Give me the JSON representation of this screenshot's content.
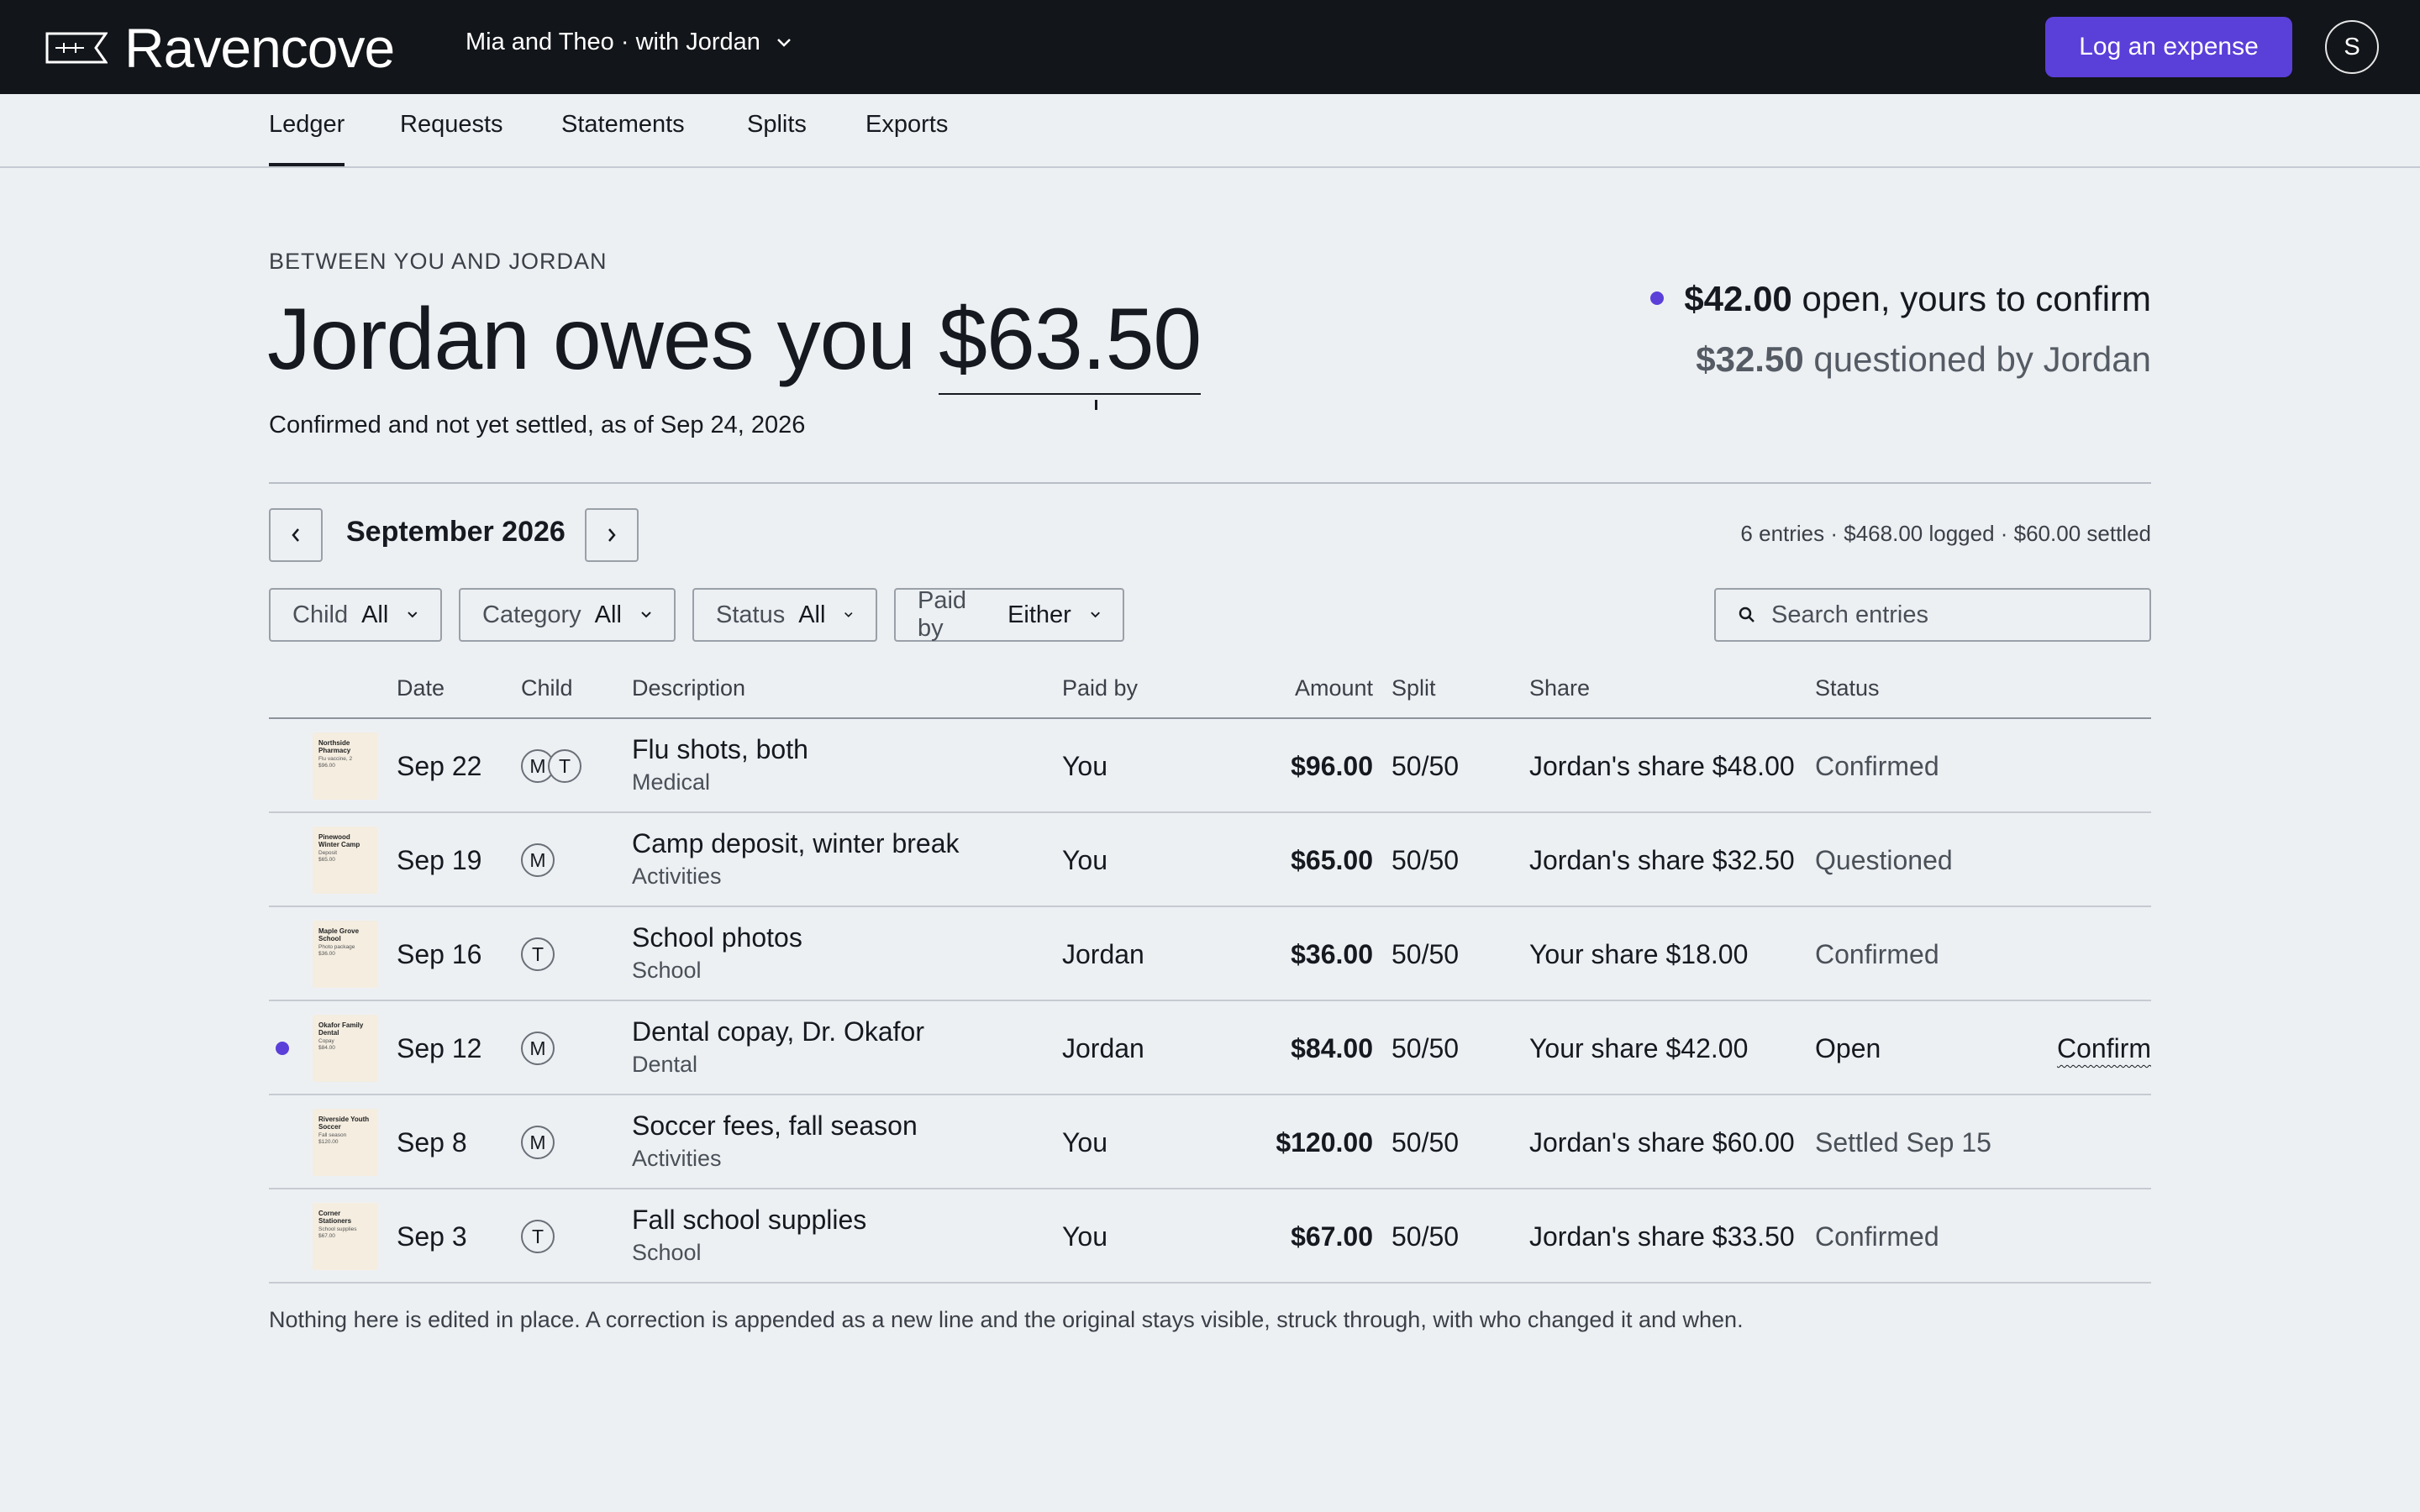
{
  "app": {
    "brand": "Ravencove",
    "household": "Mia and Theo · with Jordan",
    "log_expense": "Log an expense",
    "avatar_initial": "S"
  },
  "tabs": [
    {
      "label": "Ledger",
      "active": true
    },
    {
      "label": "Requests",
      "active": false
    },
    {
      "label": "Statements",
      "active": false
    },
    {
      "label": "Splits",
      "active": false
    },
    {
      "label": "Exports",
      "active": false
    }
  ],
  "hero": {
    "eyebrow": "BETWEEN YOU AND JORDAN",
    "headline_prefix": "Jordan owes you",
    "headline_amount": "$63.50",
    "subtitle": "Confirmed and not yet settled, as of Sep 24, 2026"
  },
  "summary": {
    "open_amount": "$42.00",
    "open_text": "open, yours to confirm",
    "questioned_amount": "$32.50",
    "questioned_text": "questioned by Jordan"
  },
  "period": {
    "month": "September 2026",
    "meta": "6 entries · $468.00 logged · $60.00 settled"
  },
  "filters": [
    {
      "label": "Child",
      "value": "All"
    },
    {
      "label": "Category",
      "value": "All"
    },
    {
      "label": "Status",
      "value": "All"
    },
    {
      "label": "Paid by",
      "value": "Either"
    }
  ],
  "search": {
    "placeholder": "Search entries"
  },
  "columns": [
    "Date",
    "Child",
    "Description",
    "Paid by",
    "Amount",
    "Split",
    "Share",
    "Status"
  ],
  "rows": [
    {
      "date": "Sep 22",
      "children": [
        "M",
        "T"
      ],
      "description": "Flu shots, both",
      "category": "Medical",
      "paid_by": "You",
      "amount": "$96.00",
      "split": "50/50",
      "share": "Jordan's share $48.00",
      "status": "Confirmed",
      "receipt": {
        "merchant": "Northside Pharmacy",
        "line": "Flu vaccine, 2",
        "total": "$96.00"
      }
    },
    {
      "date": "Sep 19",
      "children": [
        "M"
      ],
      "description": "Camp deposit, winter break",
      "category": "Activities",
      "paid_by": "You",
      "amount": "$65.00",
      "split": "50/50",
      "share": "Jordan's share $32.50",
      "status": "Questioned",
      "receipt": {
        "merchant": "Pinewood Winter Camp",
        "line": "Deposit",
        "total": "$65.00"
      }
    },
    {
      "date": "Sep 16",
      "children": [
        "T"
      ],
      "description": "School photos",
      "category": "School",
      "paid_by": "Jordan",
      "amount": "$36.00",
      "split": "50/50",
      "share": "Your share $18.00",
      "status": "Confirmed",
      "receipt": {
        "merchant": "Maple Grove School",
        "line": "Photo package",
        "total": "$36.00"
      }
    },
    {
      "date": "Sep 12",
      "children": [
        "M"
      ],
      "description": "Dental copay, Dr. Okafor",
      "category": "Dental",
      "paid_by": "Jordan",
      "amount": "$84.00",
      "split": "50/50",
      "share": "Your share $42.00",
      "status": "Open",
      "action": "Confirm",
      "receipt": {
        "merchant": "Okafor Family Dental",
        "line": "Copay",
        "total": "$84.00"
      }
    },
    {
      "date": "Sep 8",
      "children": [
        "M"
      ],
      "description": "Soccer fees, fall season",
      "category": "Activities",
      "paid_by": "You",
      "amount": "$120.00",
      "split": "50/50",
      "share": "Jordan's share $60.00",
      "status": "Settled Sep 15",
      "receipt": {
        "merchant": "Riverside Youth Soccer",
        "line": "Fall season",
        "total": "$120.00"
      }
    },
    {
      "date": "Sep 3",
      "children": [
        "T"
      ],
      "description": "Fall school supplies",
      "category": "School",
      "paid_by": "You",
      "amount": "$67.00",
      "split": "50/50",
      "share": "Jordan's share $33.50",
      "status": "Confirmed",
      "receipt": {
        "merchant": "Corner Stationers",
        "line": "School supplies",
        "total": "$67.00"
      }
    }
  ],
  "footnote": "Nothing here is edited in place. A correction is appended as a new line and the original stays visible, struck through, with who changed it and when.",
  "colors": {
    "accent": "#5b3fd9",
    "topbar": "#121519",
    "background": "#edf0f3",
    "receipt": "#f4ede0"
  }
}
